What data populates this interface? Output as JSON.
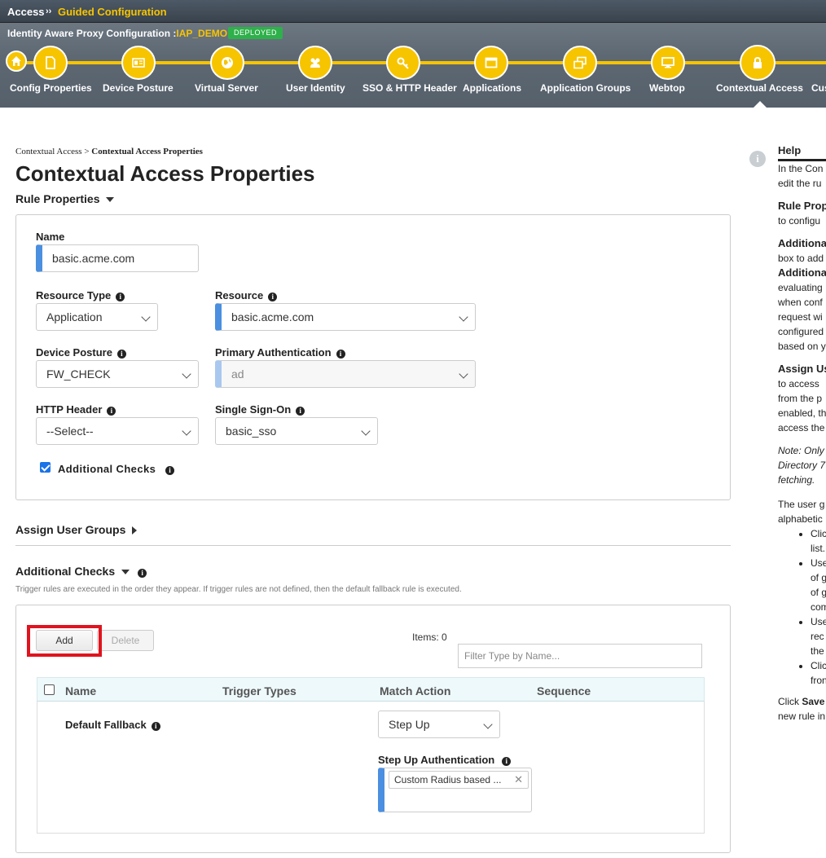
{
  "topbar": {
    "section": "Access",
    "separator": "››",
    "current": "Guided Configuration"
  },
  "subbar": {
    "config_label": "Identity Aware Proxy Configuration :",
    "config_name": "IAP_DEMO",
    "status_badge": "DEPLOYED"
  },
  "steps": [
    {
      "label": "Config Properties",
      "icon": "document-icon"
    },
    {
      "label": "Device Posture",
      "icon": "id-card-icon"
    },
    {
      "label": "Virtual Server",
      "icon": "globe-icon"
    },
    {
      "label": "User Identity",
      "icon": "users-icon"
    },
    {
      "label": "SSO & HTTP Header",
      "icon": "key-icon"
    },
    {
      "label": "Applications",
      "icon": "window-icon"
    },
    {
      "label": "Application Groups",
      "icon": "windows-icon"
    },
    {
      "label": "Webtop",
      "icon": "monitor-icon"
    },
    {
      "label": "Contextual Access",
      "icon": "lock-icon",
      "active": true
    },
    {
      "label": "Cus"
    }
  ],
  "breadcrumb": {
    "parent": "Contextual Access",
    "sep": " > ",
    "current": "Contextual Access Properties"
  },
  "page_title": "Contextual Access Properties",
  "rule_properties": {
    "header": "Rule Properties",
    "name_label": "Name",
    "name_value": "basic.acme.com",
    "resource_type_label": "Resource Type",
    "resource_type_value": "Application",
    "resource_label": "Resource",
    "resource_value": "basic.acme.com",
    "device_posture_label": "Device Posture",
    "device_posture_value": "FW_CHECK",
    "primary_auth_label": "Primary Authentication",
    "primary_auth_value": "ad",
    "http_header_label": "HTTP Header",
    "http_header_value": "--Select--",
    "sso_label": "Single Sign-On",
    "sso_value": "basic_sso",
    "additional_checks_label": "Additional Checks",
    "additional_checks_checked": true
  },
  "assign_user_groups": {
    "header": "Assign User Groups"
  },
  "additional_checks": {
    "header": "Additional Checks",
    "note": "Trigger rules are executed in the order they appear. If trigger rules are not defined, then the default fallback rule is executed.",
    "add_label": "Add",
    "delete_label": "Delete",
    "items_label": "Items: 0",
    "filter_placeholder": "Filter Type by Name...",
    "columns": [
      "Name",
      "Trigger Types",
      "Match Action",
      "Sequence"
    ],
    "row": {
      "name": "Default Fallback",
      "match_action": "Step Up",
      "step_up_label": "Step Up Authentication",
      "step_up_tag": "Custom Radius based ..."
    }
  },
  "help": {
    "title": "Help",
    "lines": [
      "In the Con",
      "edit the ru"
    ],
    "rule_prop_title": "Rule Prop",
    "rule_prop_line": "to configu",
    "addl_title": "Additiona",
    "addl_lines": [
      "box to add"
    ],
    "addl_title2": "Additiona",
    "addl_lines2": [
      "evaluating",
      "when conf",
      "request wi",
      "configured",
      "based on y"
    ],
    "assign_title": "Assign Us",
    "assign_lines": [
      "to access",
      "from the p",
      "enabled, th",
      "access the"
    ],
    "note_lines": [
      "Note: Only",
      "Directory 7",
      "fetching."
    ],
    "user_g_lines": [
      "The user g",
      "alphabetic"
    ],
    "bullets": [
      [
        "Clic",
        "list."
      ],
      [
        "Use",
        "of g",
        "of g",
        "com"
      ],
      [
        "Use",
        "rec",
        "the"
      ],
      [
        "Clic",
        "fron"
      ]
    ],
    "click_line": "Click ",
    "click_bold": "Save",
    "new_rule_line": "new rule in"
  },
  "colors": {
    "accent": "#f7c400",
    "header_bg": "#5d6873",
    "deployed": "#2eb04a",
    "highlight_box": "#e0141e",
    "input_accent": "#4a8fe0"
  }
}
